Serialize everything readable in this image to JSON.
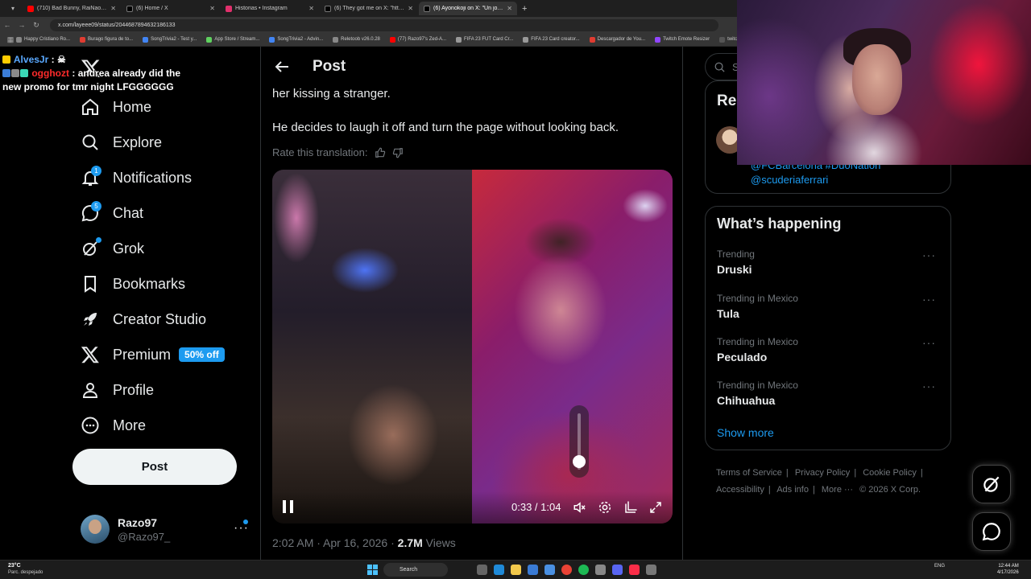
{
  "browser": {
    "tabs": [
      {
        "title": "(710) Bad Bunny, RaiNao - PER",
        "color": "#ff0000"
      },
      {
        "title": "(6) Home / X",
        "color": "#000000"
      },
      {
        "title": "Historias • Instagram",
        "color": "#e1306c"
      },
      {
        "title": "(6) They got me on X: \"https://",
        "color": "#000000"
      },
      {
        "title": "(6) Ayonokoji on X: \"Un joven",
        "color": "#000000"
      }
    ],
    "url": "x.com/layeee09/status/2044687894632186133",
    "bookmarks": [
      {
        "label": "Happy Cristiano Ro...",
        "color": "#888888"
      },
      {
        "label": "Burago figura de to...",
        "color": "#e03c31"
      },
      {
        "label": "SongTrivia2 - Test y...",
        "color": "#4285f4"
      },
      {
        "label": "App Store / Stream...",
        "color": "#5fd15f"
      },
      {
        "label": "SongTrivia2 - Advin...",
        "color": "#4285f4"
      },
      {
        "label": "Reletoob v26.0.28",
        "color": "#888888"
      },
      {
        "label": "(77) Razo97's Zed-A...",
        "color": "#ff0000"
      },
      {
        "label": "FIFA 23 FUT Card Cr...",
        "color": "#999999"
      },
      {
        "label": "FIFA 23 Card creator...",
        "color": "#999999"
      },
      {
        "label": "Descargador de You...",
        "color": "#e03c31"
      },
      {
        "label": "Twitch Emote Resizer",
        "color": "#9146ff"
      },
      {
        "label": "twitch emote re",
        "color": "#555555"
      }
    ]
  },
  "chat": {
    "line1": {
      "user": "AlvesJr",
      "sep": ":"
    },
    "line2": {
      "user": "ogghozt",
      "sep": ":",
      "message": "andrea already did the new promo for tmr night LFGGGGGG"
    }
  },
  "sidebar": {
    "items": [
      {
        "label": "Home",
        "icon": "home-icon"
      },
      {
        "label": "Explore",
        "icon": "search-icon"
      },
      {
        "label": "Notifications",
        "icon": "bell-icon",
        "badge": "1"
      },
      {
        "label": "Chat",
        "icon": "chat-icon",
        "badge": "5"
      },
      {
        "label": "Grok",
        "icon": "grok-icon"
      },
      {
        "label": "Bookmarks",
        "icon": "bookmark-icon"
      },
      {
        "label": "Creator Studio",
        "icon": "rocket-icon"
      },
      {
        "label": "Premium",
        "icon": "x-logo-icon",
        "promo": "50% off"
      },
      {
        "label": "Profile",
        "icon": "person-icon"
      },
      {
        "label": "More",
        "icon": "more-circle-icon"
      }
    ],
    "post_button": "Post",
    "account": {
      "name": "Razo97",
      "handle": "@Razo97_"
    }
  },
  "main": {
    "header_title": "Post",
    "text_line1": "her kissing a stranger.",
    "text_line2": "He decides to laugh it off and turn the page without looking back.",
    "rate_label": "Rate this translation:",
    "video": {
      "time": "0:33 / 1:04",
      "volume": 0.15
    },
    "meta": {
      "time": "2:02 AM · Apr 16, 2026 ·",
      "views": "2.7M",
      "views_label": "Views"
    }
  },
  "right": {
    "search_placeholder": "Se",
    "relevant_title": "Rel",
    "relevant_links": [
      "@FCBarcelona #DuoNation",
      "@scuderiaferrari"
    ],
    "trends_title": "What’s happening",
    "trends": [
      {
        "context": "Trending",
        "name": "Druski"
      },
      {
        "context": "Trending in Mexico",
        "name": "Tula"
      },
      {
        "context": "Trending in Mexico",
        "name": "Peculado"
      },
      {
        "context": "Trending in Mexico",
        "name": "Chihuahua"
      }
    ],
    "show_more": "Show more",
    "footer": [
      "Terms of Service",
      "|",
      "Privacy Policy",
      "|",
      "Cookie Policy",
      "|",
      "Accessibility",
      "|",
      "Ads info",
      "|",
      "More ···",
      "© 2026 X Corp."
    ]
  },
  "taskbar": {
    "weather_temp": "23°C",
    "weather_desc": "Parc. despejado",
    "search": "Search",
    "lang": "ENG",
    "time": "12:44 AM",
    "date": "4/17/2026"
  }
}
